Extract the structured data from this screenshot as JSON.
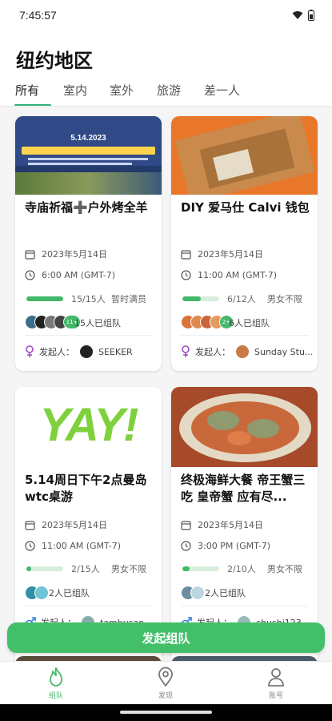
{
  "status": {
    "time": "7:45:57"
  },
  "page": {
    "title": "纽约地区"
  },
  "tabs": [
    {
      "label": "所有"
    },
    {
      "label": "室内"
    },
    {
      "label": "室外"
    },
    {
      "label": "旅游"
    },
    {
      "label": "差一人"
    }
  ],
  "cards": [
    {
      "title": "寺庙祈福➕户外烤全羊",
      "banner_date": "5.14.2023",
      "date": "2023年5月14日",
      "time": "6:00 AM (GMT-7)",
      "count": "15/15人",
      "fill": 1.0,
      "status": "暂时满员",
      "team": "15人已组队",
      "more_badge": "11+",
      "organizer_label": "发起人：",
      "organizer": "SEEKER"
    },
    {
      "title": "DIY 爱马仕 Calvi 钱包",
      "date": "2023年5月14日",
      "time": "11:00 AM (GMT-7)",
      "count": "6/12人",
      "fill": 0.5,
      "status": "男女不限",
      "team": "6人已组队",
      "more_badge": "2+",
      "organizer_label": "发起人：",
      "organizer": "Sunday Stu..."
    },
    {
      "title": "5.14周日下午2点曼岛wtc桌游",
      "logo_text": "YAY!",
      "date": "2023年5月14日",
      "time": "11:00 AM (GMT-7)",
      "count": "2/15人",
      "fill": 0.13,
      "status": "男女不限",
      "team": "2人已组队",
      "organizer_label": "发起人：",
      "organizer": "tambusan"
    },
    {
      "title": "终极海鲜大餐 帝王蟹三吃 皇帝蟹 应有尽...",
      "date": "2023年5月14日",
      "time": "3:00 PM (GMT-7)",
      "count": "2/10人",
      "fill": 0.2,
      "status": "男女不限",
      "team": "2人已组队",
      "organizer_label": "发起人：",
      "organizer": "chushi123"
    }
  ],
  "cta": {
    "label": "发起组队"
  },
  "nav": [
    {
      "label": "组队",
      "icon": "flame-icon"
    },
    {
      "label": "发现",
      "icon": "location-pin-icon"
    },
    {
      "label": "账号",
      "icon": "person-icon"
    }
  ],
  "colors": {
    "accent": "#43b86b",
    "cta": "#43bf6a"
  }
}
